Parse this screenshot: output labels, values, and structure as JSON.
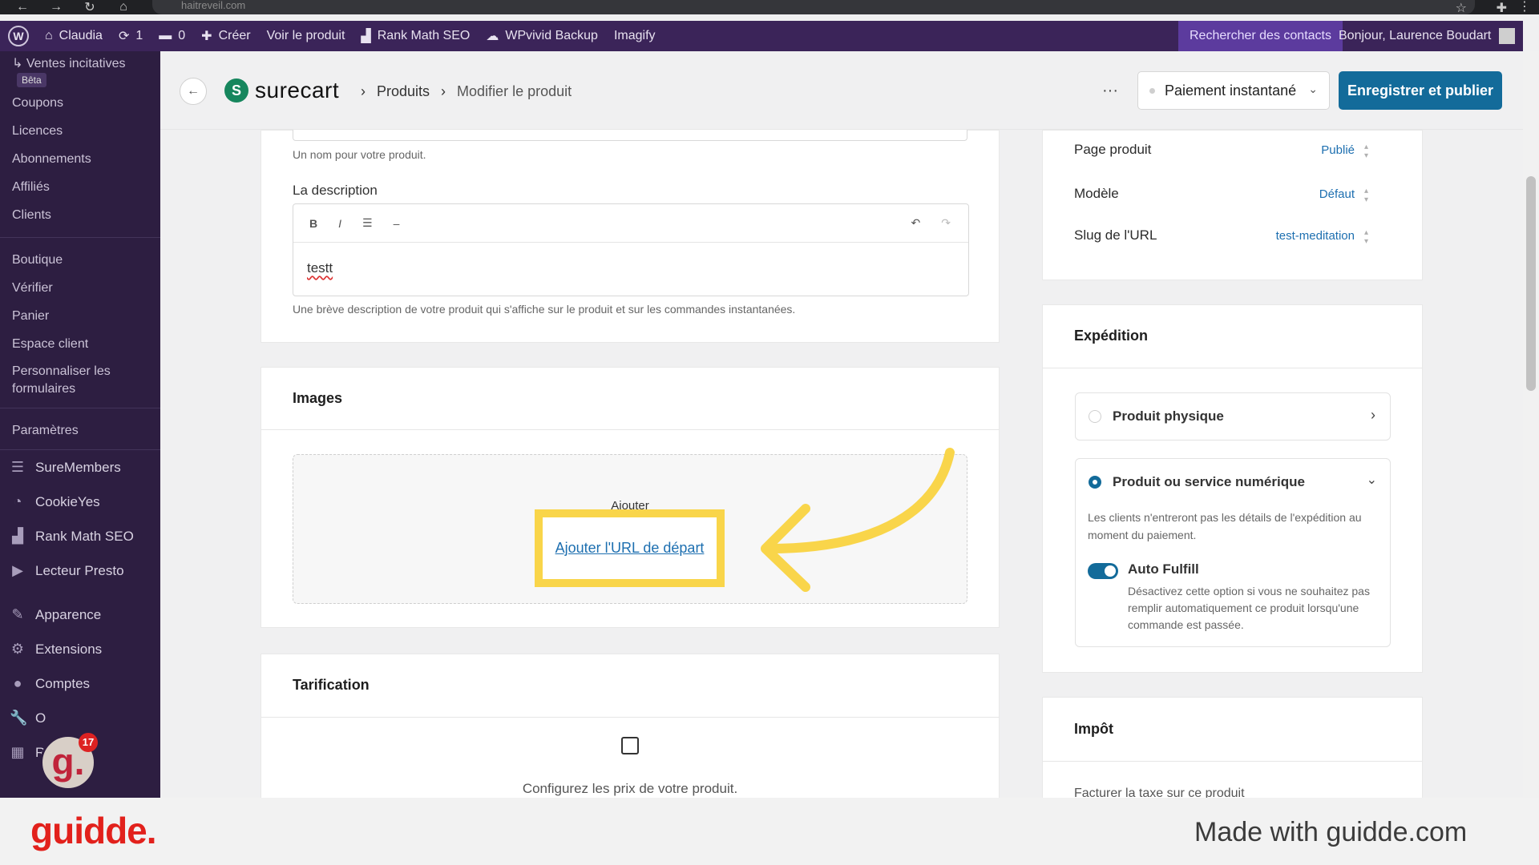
{
  "browser": {
    "url": "haitreveil.com"
  },
  "adminbar": {
    "site": "Claudia",
    "updates": "1",
    "comments": "0",
    "create": "Créer",
    "view_product": "Voir le produit",
    "rank_math": "Rank Math SEO",
    "backup": "WPvivid Backup",
    "imagify": "Imagify",
    "search_contacts": "Rechercher des contacts",
    "greeting": "Bonjour, Laurence Boudart"
  },
  "sidebar": {
    "sub_items": [
      {
        "label": "↳ Ventes incitatives",
        "badge": "Bêta"
      },
      {
        "label": "Coupons"
      },
      {
        "label": "Licences"
      },
      {
        "label": "Abonnements"
      },
      {
        "label": "Affiliés"
      },
      {
        "label": "Clients"
      }
    ],
    "sub_items2": [
      "Boutique",
      "Vérifier",
      "Panier",
      "Espace client",
      "Personnaliser les formulaires"
    ],
    "settings": "Paramètres",
    "main_items": [
      {
        "label": "SureMembers",
        "icon": "suremembers-icon"
      },
      {
        "label": "CookieYes",
        "icon": "cookieyes-icon"
      },
      {
        "label": "Rank Math SEO",
        "icon": "rankmath-icon"
      },
      {
        "label": "Lecteur Presto",
        "icon": "presto-icon"
      },
      {
        "label": "Apparence",
        "icon": "brush-icon"
      },
      {
        "label": "Extensions",
        "icon": "plugin-icon"
      },
      {
        "label": "Comptes",
        "icon": "user-icon"
      },
      {
        "label": "O",
        "icon": "wrench-icon"
      },
      {
        "label": "R",
        "icon": "settings-icon"
      }
    ]
  },
  "header": {
    "logo": "surecart",
    "crumb1": "Produits",
    "crumb2": "Modifier le produit",
    "more": "···",
    "payment_select": "Paiement instantané",
    "publish": "Enregistrer et publier"
  },
  "main": {
    "name_hint": "Un nom pour votre produit.",
    "description_label": "La description",
    "description_value": "testt",
    "description_hint": "Une brève description de votre produit qui s'affiche sur le produit et sur les commandes instantanées.",
    "images_title": "Images",
    "add_label": "Ajouter",
    "add_url_link": "Ajouter l'URL de départ",
    "pricing_title": "Tarification",
    "pricing_hint": "Configurez les prix de votre produit."
  },
  "right": {
    "product_page_label": "Page produit",
    "product_page_value": "Publié",
    "template_label": "Modèle",
    "template_value": "Défaut",
    "slug_label": "Slug de l'URL",
    "slug_value": "test-meditation",
    "shipping_title": "Expédition",
    "physical": "Produit physique",
    "digital": "Produit ou service numérique",
    "digital_desc": "Les clients n'entreront pas les détails de l'expédition au moment du paiement.",
    "auto_fulfill": "Auto Fulfill",
    "auto_fulfill_desc": "Désactivez cette option si vous ne souhaitez pas remplir automatiquement ce produit lorsqu'une commande est passée.",
    "tax_title": "Impôt",
    "tax_row": "Facturer la taxe sur ce produit"
  },
  "badge": {
    "count": "17"
  },
  "footer": {
    "brand": "guidde.",
    "made_with": "Made with guidde.com"
  },
  "colors": {
    "accent": "#136b9a",
    "highlight": "#f9d54a",
    "adminbar": "#3b2459",
    "sidebar": "#2d1e41"
  }
}
